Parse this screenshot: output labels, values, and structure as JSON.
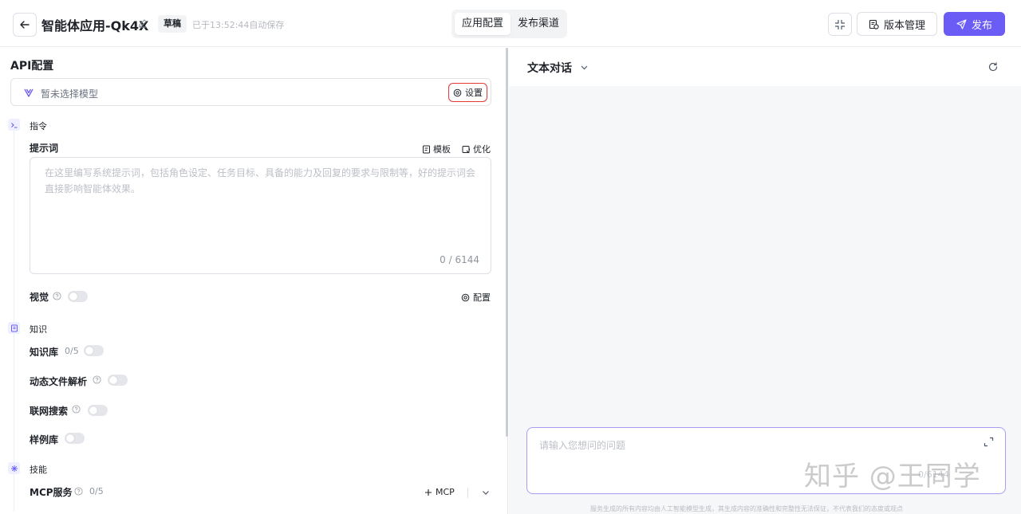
{
  "header": {
    "app_title": "智能体应用-Qk4X",
    "draft_label": "草稿",
    "autosave_text": "已于13:52:44自动保存",
    "tabs": [
      {
        "label": "应用配置",
        "active": true
      },
      {
        "label": "发布渠道",
        "active": false
      }
    ],
    "version_label": "版本管理",
    "publish_label": "发布"
  },
  "config": {
    "api_title": "API配置",
    "model_placeholder": "暂未选择模型",
    "settings_label": "设置",
    "instruction_section": "指令",
    "prompt_label": "提示词",
    "template_label": "模板",
    "optimize_label": "优化",
    "prompt_placeholder": "在这里编写系统提示词，包括角色设定、任务目标、具备的能力及回复的要求与限制等，好的提示词会直接影响智能体效果。",
    "char_count": "0 / 6144",
    "vision_label": "视觉",
    "vision_config_label": "配置",
    "knowledge_section": "知识",
    "kb_label": "知识库",
    "kb_count": "0/5",
    "dynamic_file_label": "动态文件解析",
    "web_search_label": "联网搜索",
    "examples_label": "样例库",
    "skills_section": "技能",
    "mcp_label": "MCP服务",
    "mcp_count": "0/5",
    "mcp_add_label": "MCP",
    "toggles": {
      "vision": false,
      "kb": false,
      "dynamic_file": false,
      "web_search": false,
      "examples": false
    }
  },
  "chat": {
    "title": "文本对话",
    "input_placeholder": "请输入您想问的问题",
    "input_count": "0/6144",
    "disclaimer": "服务生成的所有内容均由人工智能模型生成，其生成内容的准确性和完整性无法保证，不代表我们的态度或观点"
  },
  "watermark": "知乎 @王同学",
  "colors": {
    "accent": "#6b5cf6",
    "highlight": "#e53935"
  }
}
